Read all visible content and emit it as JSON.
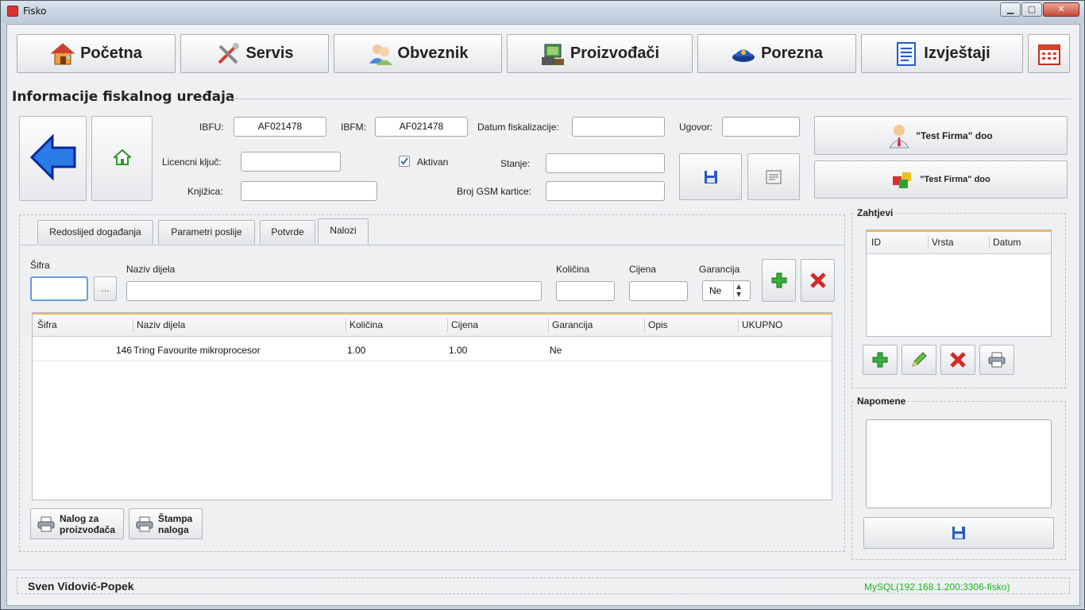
{
  "window": {
    "title": "Fisko",
    "min": "▁",
    "max": "▢",
    "close": "✕"
  },
  "nav": [
    {
      "label": "Početna",
      "icon": "house-icon"
    },
    {
      "label": "Servis",
      "icon": "tools-icon"
    },
    {
      "label": "Obveznik",
      "icon": "users-icon"
    },
    {
      "label": "Proizvođači",
      "icon": "factory-icon"
    },
    {
      "label": "Porezna",
      "icon": "police-cap-icon"
    },
    {
      "label": "Izvještaji",
      "icon": "report-icon"
    },
    {
      "label": "",
      "icon": "calendar-icon"
    }
  ],
  "section_title": "Informacije fiskalnog uređaja",
  "form": {
    "ibfu_label": "IBFU:",
    "ibfu_value": "AF021478",
    "ibfm_label": "IBFM:",
    "ibfm_value": "AF021478",
    "datum_label": "Datum fiskalizacije:",
    "datum_value": "",
    "ugovor_label": "Ugovor:",
    "ugovor_value": "",
    "licencni_label": "Licencni ključ:",
    "licencni_value": "",
    "aktivan_label": "Aktivan",
    "aktivan_checked": true,
    "stanje_label": "Stanje:",
    "stanje_value": "",
    "knjizica_label": "Knjižica:",
    "knjizica_value": "",
    "gsm_label": "Broj GSM kartice:",
    "gsm_value": ""
  },
  "firm_buttons": [
    "\"Test Firma\" doo",
    "\"Test Firma\" doo"
  ],
  "tabs": [
    "Redoslijed događanja",
    "Parametri poslije",
    "Potvrde",
    "Nalozi"
  ],
  "active_tab": "Nalozi",
  "nalozi": {
    "sifra_label": "Šifra",
    "browse_label": "...",
    "naziv_label": "Naziv dijela",
    "kolicina_label": "Količina",
    "cijena_label": "Cijena",
    "garancija_label": "Garancija",
    "garancija_value": "Ne",
    "columns": [
      "Šifra",
      "Naziv dijela",
      "Količina",
      "Cijena",
      "Garancija",
      "Opis",
      "UKUPNO"
    ],
    "rows": [
      {
        "sifra": "146",
        "naziv": "Tring Favourite mikroprocesor",
        "kolicina": "1.00",
        "cijena": "1.00",
        "garancija": "Ne",
        "opis": "",
        "ukupno": ""
      }
    ],
    "btn_nalog_proizvodaca": "Nalog za\nproizvođača",
    "btn_stampa": "Štampa\nnaloga"
  },
  "zahtjevi": {
    "title": "Zahtjevi",
    "columns": [
      "ID",
      "Vrsta",
      "Datum"
    ]
  },
  "napomene": {
    "title": "Napomene",
    "value": ""
  },
  "status": {
    "user": "Sven Vidović-Popek",
    "db": "MySQL(192.168.1.200:3306-fisko)",
    "db_color": "#22b022"
  },
  "colors": {
    "accent_orange": "#f2b94c",
    "green": "#2a9a2a",
    "red": "#d42a2a",
    "blue": "#2a5fc8"
  }
}
